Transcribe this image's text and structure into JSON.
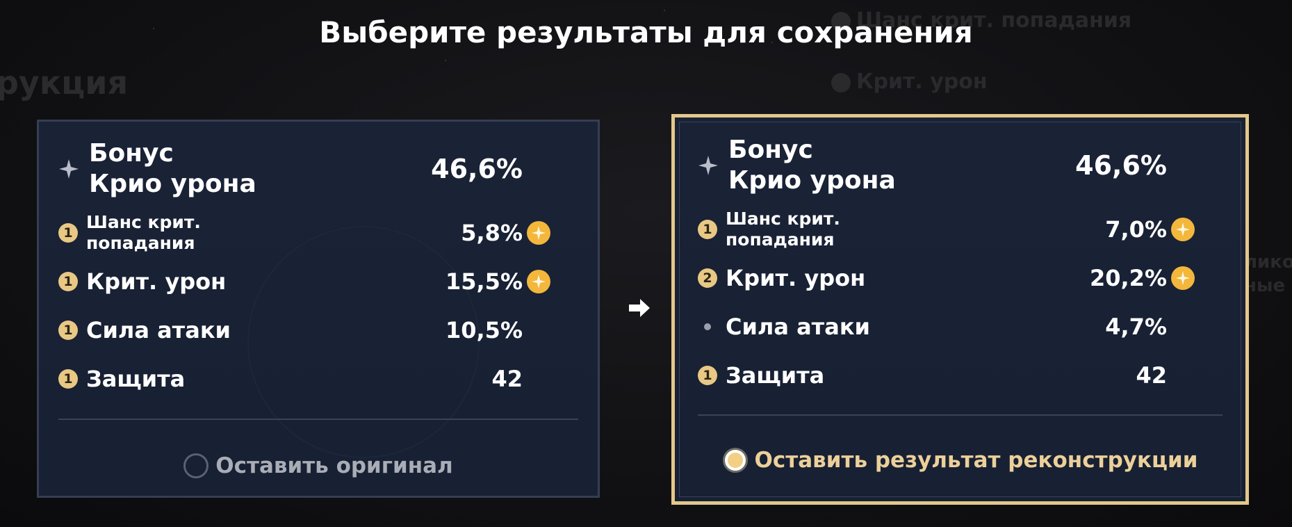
{
  "title": "Выберите результаты для сохранения",
  "background": {
    "left_word": "рукция",
    "right_line1": "Шанс крит. попадания",
    "right_line2": "Крит. урон",
    "right_edge1": "лико",
    "right_edge2": "ные"
  },
  "left_panel": {
    "main_stat": {
      "label_line1": "Бонус",
      "label_line2": "Крио урона",
      "value": "46,6%"
    },
    "substats": [
      {
        "badge": "1",
        "label_line1": "Шанс крит.",
        "label_line2": "попадания",
        "value": "5,8%",
        "boosted": true
      },
      {
        "badge": "1",
        "label": "Крит. урон",
        "value": "15,5%",
        "boosted": true
      },
      {
        "badge": "1",
        "label": "Сила атаки",
        "value": "10,5%",
        "boosted": false
      },
      {
        "badge": "1",
        "label": "Защита",
        "value": "42",
        "boosted": false
      }
    ],
    "choice_label": "Оставить оригинал",
    "selected": false
  },
  "right_panel": {
    "main_stat": {
      "label_line1": "Бонус",
      "label_line2": "Крио урона",
      "value": "46,6%"
    },
    "substats": [
      {
        "badge": "1",
        "label_line1": "Шанс крит.",
        "label_line2": "попадания",
        "value": "7,0%",
        "boosted": true
      },
      {
        "badge": "2",
        "label": "Крит. урон",
        "value": "20,2%",
        "boosted": true
      },
      {
        "badge": "",
        "label": "Сила атаки",
        "value": "4,7%",
        "boosted": false
      },
      {
        "badge": "1",
        "label": "Защита",
        "value": "42",
        "boosted": false
      }
    ],
    "choice_label": "Оставить результат реконструкции",
    "selected": true
  },
  "colors": {
    "accent_gold": "#e3c88b",
    "panel_bg": "#1a2236",
    "badge": "#e8c884",
    "boost": "#f3b73c"
  }
}
